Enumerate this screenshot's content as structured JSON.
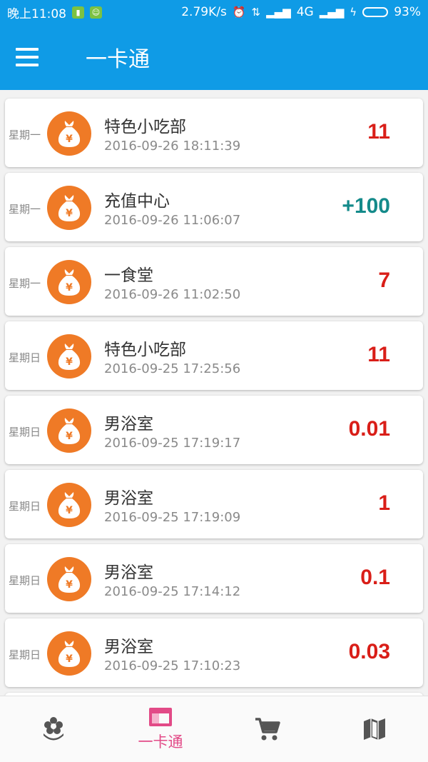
{
  "status_bar": {
    "time": "晚上11:08",
    "net_speed": "2.79K/s",
    "network": "4G",
    "battery": "93%",
    "battery_fraction": 0.93
  },
  "app_bar": {
    "title": "一卡通",
    "menu_icon": "menu-icon"
  },
  "transactions": [
    {
      "weekday": "星期一",
      "merchant": "特色小吃部",
      "time": "2016-09-26 18:11:39",
      "amount": "11",
      "type": "debit"
    },
    {
      "weekday": "星期一",
      "merchant": "充值中心",
      "time": "2016-09-26 11:06:07",
      "amount": "+100",
      "type": "credit"
    },
    {
      "weekday": "星期一",
      "merchant": "一食堂",
      "time": "2016-09-26 11:02:50",
      "amount": "7",
      "type": "debit"
    },
    {
      "weekday": "星期日",
      "merchant": "特色小吃部",
      "time": "2016-09-25 17:25:56",
      "amount": "11",
      "type": "debit"
    },
    {
      "weekday": "星期日",
      "merchant": "男浴室",
      "time": "2016-09-25 17:19:17",
      "amount": "0.01",
      "type": "debit"
    },
    {
      "weekday": "星期日",
      "merchant": "男浴室",
      "time": "2016-09-25 17:19:09",
      "amount": "1",
      "type": "debit"
    },
    {
      "weekday": "星期日",
      "merchant": "男浴室",
      "time": "2016-09-25 17:14:12",
      "amount": "0.1",
      "type": "debit"
    },
    {
      "weekday": "星期日",
      "merchant": "男浴室",
      "time": "2016-09-25 17:10:23",
      "amount": "0.03",
      "type": "debit"
    }
  ],
  "bottom_nav": {
    "active_label": "一卡通",
    "items": [
      "flower-icon",
      "card-icon",
      "cart-icon",
      "map-icon"
    ]
  },
  "colors": {
    "primary": "#0f9be6",
    "debit": "#d91e18",
    "credit": "#148a8a",
    "avatar": "#ef7a26",
    "nav_active": "#e24a87",
    "nav_inactive": "#555555"
  }
}
